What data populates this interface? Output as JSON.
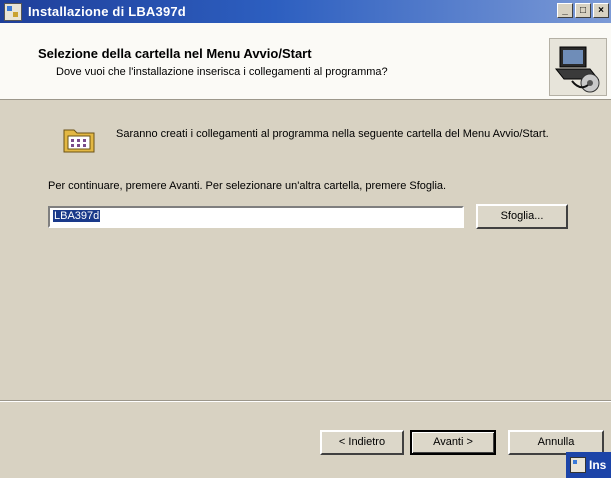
{
  "window": {
    "title": "Installazione di LBA397d",
    "controls": [
      "_",
      "□",
      "×"
    ]
  },
  "header": {
    "title": "Selezione della cartella nel Menu Avvio/Start",
    "subtitle": "Dove vuoi che l'installazione inserisca i collegamenti al programma?",
    "graphic_icon": "setup-computer-icon"
  },
  "content": {
    "info_icon": "folder-icon",
    "info_text": "Saranno creati i collegamenti al programma nella seguente cartella del Menu Avvio/Start.",
    "continue_text": "Per continuare, premere Avanti. Per selezionare un'altra cartella, premere Sfoglia.",
    "folder_value": "LBA397d",
    "browse_label": "Sfoglia..."
  },
  "footer": {
    "back_label": "< Indietro",
    "next_label": "Avanti >",
    "cancel_label": "Annulla"
  },
  "taskbar": {
    "label": "Ins"
  },
  "colors": {
    "title_bar": "#1f3f9a",
    "selection": "#1a3a8a",
    "dialog_bg": "#d8d2c2"
  }
}
